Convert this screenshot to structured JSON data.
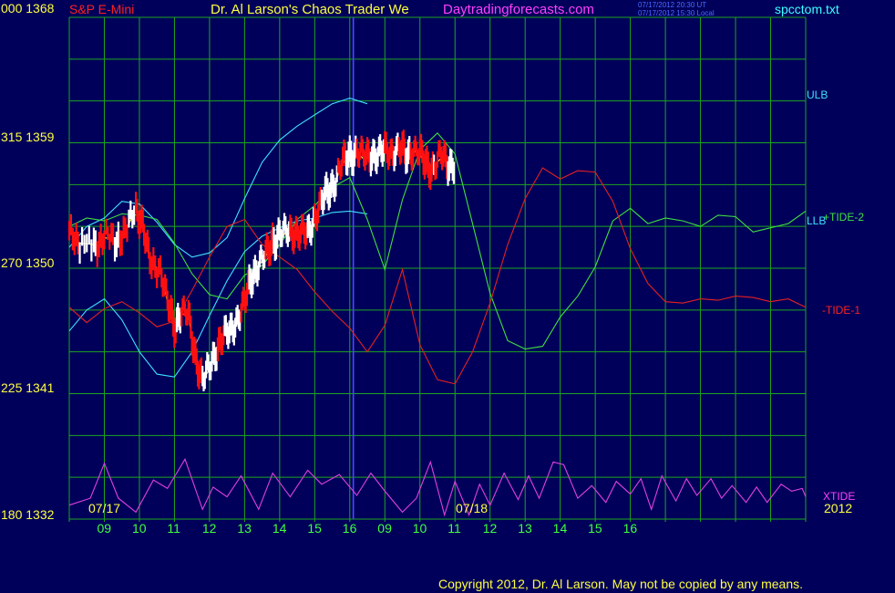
{
  "header": {
    "symbol": "S&P E-Mini",
    "left_corner": "000  1368",
    "title": "Dr. Al Larson's Chaos Trader We",
    "site": "Daytradingforecasts.com",
    "timestamp_ut": "07/17/2012 20:30 UT",
    "timestamp_local": "07/17/2012 15:30 Local",
    "filename": "spcctom.txt"
  },
  "footer": {
    "copyright": "Copyright 2012, Dr. Al Larson. May not be copied by any means.",
    "year": "2012"
  },
  "colors": {
    "background": "#00005a",
    "grid": "#1ea51e",
    "divider": "#4a4aff",
    "price_up": "#ffffff",
    "price_down": "#ff1010",
    "bands": "#40e0ff",
    "tide1": "#e52020",
    "tide2": "#40e040",
    "xtide": "#e040e0",
    "moving_avg": "#ffff40",
    "axis_text": "#ffff40",
    "hour_labels": "#40ff40"
  },
  "chart_data": {
    "type": "line",
    "ylim": [
      1332,
      1368
    ],
    "y_ticks": [
      {
        "value": 1368,
        "label": ""
      },
      {
        "value": 1359,
        "label": "315  1359"
      },
      {
        "value": 1350,
        "label": "270  1350"
      },
      {
        "value": 1341,
        "label": "225  1341"
      },
      {
        "value": 1332,
        "label": "180  1332"
      }
    ],
    "date_labels": [
      "07/17",
      "07/18"
    ],
    "x_tick_labels": [
      "09",
      "10",
      "11",
      "12",
      "13",
      "14",
      "15",
      "16",
      "09",
      "10",
      "11",
      "12",
      "13",
      "14",
      "15",
      "16"
    ],
    "series": [
      {
        "name": "ULB",
        "values": [
          [
            0,
            1351.5
          ],
          [
            0.5,
            1353
          ],
          [
            1,
            1353.6
          ],
          [
            1.5,
            1354.8
          ],
          [
            2,
            1354.6
          ],
          [
            2.5,
            1353.3
          ],
          [
            3,
            1351.7
          ],
          [
            3.5,
            1350.8
          ],
          [
            4,
            1351.1
          ],
          [
            4.5,
            1352.2
          ],
          [
            5,
            1355
          ],
          [
            5.5,
            1357.6
          ],
          [
            6,
            1359.2
          ],
          [
            6.5,
            1360.2
          ],
          [
            7,
            1361
          ],
          [
            7.5,
            1361.8
          ],
          [
            8,
            1362.2
          ],
          [
            8.5,
            1361.8
          ]
        ]
      },
      {
        "name": "LLB",
        "values": [
          [
            0,
            1345.5
          ],
          [
            0.5,
            1347
          ],
          [
            1,
            1347.8
          ],
          [
            1.5,
            1346.3
          ],
          [
            2,
            1344
          ],
          [
            2.5,
            1342.4
          ],
          [
            3,
            1342.2
          ],
          [
            3.5,
            1344
          ],
          [
            4,
            1346.6
          ],
          [
            4.5,
            1349.1
          ],
          [
            5,
            1351.2
          ],
          [
            5.5,
            1352.3
          ],
          [
            6,
            1352.9
          ],
          [
            6.5,
            1353.4
          ],
          [
            7,
            1353.6
          ],
          [
            7.5,
            1354
          ],
          [
            8,
            1354.1
          ],
          [
            8.5,
            1353.9
          ]
        ]
      },
      {
        "name": "+TIDE-2",
        "values": [
          [
            0,
            1353
          ],
          [
            0.5,
            1353.6
          ],
          [
            1,
            1353.4
          ],
          [
            1.5,
            1353.9
          ],
          [
            2,
            1353.8
          ],
          [
            2.5,
            1353.5
          ],
          [
            3,
            1351.8
          ],
          [
            3.5,
            1349.6
          ],
          [
            4,
            1348.1
          ],
          [
            4.5,
            1347.8
          ],
          [
            5,
            1349.5
          ],
          [
            5.5,
            1350.2
          ],
          [
            6,
            1351.7
          ],
          [
            6.5,
            1353.5
          ],
          [
            7,
            1354.5
          ],
          [
            7.5,
            1355.8
          ],
          [
            8,
            1356.5
          ],
          [
            8.5,
            1353.5
          ],
          [
            9,
            1349.9
          ],
          [
            9.5,
            1354.9
          ],
          [
            10,
            1358.5
          ],
          [
            10.5,
            1359.7
          ],
          [
            11,
            1358.2
          ],
          [
            11.5,
            1353.2
          ],
          [
            12,
            1348.2
          ],
          [
            12.5,
            1344.8
          ],
          [
            13,
            1344.2
          ],
          [
            13.5,
            1344.4
          ],
          [
            14,
            1346.5
          ],
          [
            14.5,
            1348
          ],
          [
            15,
            1350.1
          ],
          [
            15.5,
            1353.4
          ],
          [
            16,
            1354.3
          ],
          [
            16.5,
            1353.2
          ],
          [
            17,
            1353.6
          ],
          [
            17.5,
            1353.4
          ],
          [
            18,
            1353
          ],
          [
            18.5,
            1353.8
          ],
          [
            19,
            1353.7
          ],
          [
            19.5,
            1352.6
          ],
          [
            20,
            1352.9
          ],
          [
            20.5,
            1353.2
          ],
          [
            21,
            1354.1
          ]
        ]
      },
      {
        "name": "-TIDE-1",
        "values": [
          [
            0,
            1347.2
          ],
          [
            0.5,
            1346.1
          ],
          [
            1,
            1347.1
          ],
          [
            1.5,
            1347.6
          ],
          [
            2,
            1346.8
          ],
          [
            2.5,
            1345.8
          ],
          [
            3,
            1346.2
          ],
          [
            3.5,
            1348.4
          ],
          [
            4,
            1350.8
          ],
          [
            4.5,
            1353
          ],
          [
            5,
            1353.5
          ],
          [
            5.5,
            1351.7
          ],
          [
            6,
            1350.8
          ],
          [
            6.5,
            1349.9
          ],
          [
            7,
            1348.3
          ],
          [
            7.5,
            1346.9
          ],
          [
            8,
            1345.7
          ],
          [
            8.5,
            1344
          ],
          [
            9,
            1345.9
          ],
          [
            9.5,
            1349.9
          ],
          [
            10,
            1344.5
          ],
          [
            10.5,
            1342
          ],
          [
            11,
            1341.7
          ],
          [
            11.5,
            1344
          ],
          [
            12,
            1347.5
          ],
          [
            12.5,
            1351.7
          ],
          [
            13,
            1355
          ],
          [
            13.5,
            1357.2
          ],
          [
            14,
            1356.4
          ],
          [
            14.5,
            1357
          ],
          [
            15,
            1356.9
          ],
          [
            15.5,
            1354.8
          ],
          [
            16,
            1351.4
          ],
          [
            16.5,
            1348.9
          ],
          [
            17,
            1347.6
          ],
          [
            17.5,
            1347.5
          ],
          [
            18,
            1347.8
          ],
          [
            18.5,
            1347.7
          ],
          [
            19,
            1348
          ],
          [
            19.5,
            1347.9
          ],
          [
            20,
            1347.6
          ],
          [
            20.5,
            1347.8
          ],
          [
            21,
            1347.2
          ]
        ]
      },
      {
        "name": "XTIDE",
        "values": [
          [
            0,
            1333
          ],
          [
            0.6,
            1333.5
          ],
          [
            1,
            1336
          ],
          [
            1.4,
            1333.5
          ],
          [
            1.9,
            1332.5
          ],
          [
            2.4,
            1334.8
          ],
          [
            2.8,
            1334.2
          ],
          [
            3.3,
            1336.3
          ],
          [
            3.8,
            1332.7
          ],
          [
            4.1,
            1334.3
          ],
          [
            4.5,
            1333.6
          ],
          [
            4.9,
            1335.1
          ],
          [
            5.4,
            1332.7
          ],
          [
            5.8,
            1335.3
          ],
          [
            6.3,
            1333.6
          ],
          [
            6.8,
            1335.5
          ],
          [
            7.2,
            1334.5
          ],
          [
            7.7,
            1335.2
          ],
          [
            8.2,
            1333.7
          ],
          [
            8.6,
            1335.3
          ],
          [
            9,
            1334
          ],
          [
            9.5,
            1332.5
          ],
          [
            9.9,
            1333.5
          ],
          [
            10.3,
            1336.1
          ],
          [
            10.7,
            1332.3
          ],
          [
            11,
            1334.7
          ],
          [
            11.4,
            1332.3
          ],
          [
            11.7,
            1334.5
          ],
          [
            12,
            1333
          ],
          [
            12.4,
            1335.3
          ],
          [
            12.8,
            1333.4
          ],
          [
            13.1,
            1335.1
          ],
          [
            13.4,
            1333.5
          ],
          [
            13.8,
            1336.1
          ],
          [
            14.1,
            1335.9
          ],
          [
            14.5,
            1333.5
          ],
          [
            14.9,
            1334.4
          ],
          [
            15.3,
            1333.2
          ],
          [
            15.6,
            1334.7
          ],
          [
            16,
            1333.8
          ],
          [
            16.3,
            1334.9
          ],
          [
            16.6,
            1332.7
          ],
          [
            16.9,
            1335.1
          ],
          [
            17.3,
            1333.3
          ],
          [
            17.6,
            1334.9
          ],
          [
            17.9,
            1333.7
          ],
          [
            18.3,
            1334.9
          ],
          [
            18.6,
            1333.5
          ],
          [
            18.9,
            1334.4
          ],
          [
            19.3,
            1333.2
          ],
          [
            19.6,
            1334.3
          ],
          [
            19.9,
            1333.2
          ],
          [
            20.3,
            1334.5
          ],
          [
            20.6,
            1334
          ],
          [
            20.9,
            1334.2
          ],
          [
            21,
            1333.6
          ]
        ]
      },
      {
        "name": "S&P E-Mini",
        "values": [
          [
            0,
            1352.6
          ],
          [
            0.3,
            1351.8
          ],
          [
            0.7,
            1351.7
          ],
          [
            1,
            1352.2
          ],
          [
            1.3,
            1352
          ],
          [
            1.6,
            1352.6
          ],
          [
            1.9,
            1354.3
          ],
          [
            2.1,
            1353.1
          ],
          [
            2.3,
            1350.5
          ],
          [
            2.6,
            1349.8
          ],
          [
            2.8,
            1347.6
          ],
          [
            3,
            1346
          ],
          [
            3.2,
            1346.8
          ],
          [
            3.4,
            1346.5
          ],
          [
            3.6,
            1343.8
          ],
          [
            3.8,
            1342
          ],
          [
            4,
            1342.7
          ],
          [
            4.2,
            1344.3
          ],
          [
            4.4,
            1345.2
          ],
          [
            4.6,
            1345.5
          ],
          [
            4.8,
            1346.3
          ],
          [
            5,
            1347.6
          ],
          [
            5.2,
            1349.5
          ],
          [
            5.4,
            1350.2
          ],
          [
            5.6,
            1350.8
          ],
          [
            5.8,
            1352.1
          ],
          [
            6,
            1352.5
          ],
          [
            6.2,
            1352.4
          ],
          [
            6.4,
            1352.7
          ],
          [
            6.6,
            1352.6
          ],
          [
            6.8,
            1352.4
          ],
          [
            7,
            1353.6
          ],
          [
            7.2,
            1354.8
          ],
          [
            7.4,
            1355.7
          ],
          [
            7.6,
            1356.3
          ],
          [
            7.8,
            1357.5
          ],
          [
            8,
            1358.3
          ],
          [
            8.2,
            1358.4
          ],
          [
            8.4,
            1357.8
          ],
          [
            8.6,
            1358.3
          ],
          [
            8.8,
            1358.2
          ],
          [
            9,
            1358.4
          ],
          [
            9.2,
            1358.3
          ],
          [
            9.4,
            1358.6
          ],
          [
            9.6,
            1358.2
          ],
          [
            9.8,
            1358.5
          ],
          [
            10,
            1358.1
          ],
          [
            10.2,
            1357.5
          ],
          [
            10.4,
            1357.3
          ],
          [
            10.6,
            1357.9
          ],
          [
            10.8,
            1357.6
          ],
          [
            11,
            1357.6
          ]
        ]
      }
    ],
    "line_labels": [
      "ULB",
      "LLB",
      "+TIDE-2",
      "-TIDE-1",
      "XTIDE"
    ]
  }
}
